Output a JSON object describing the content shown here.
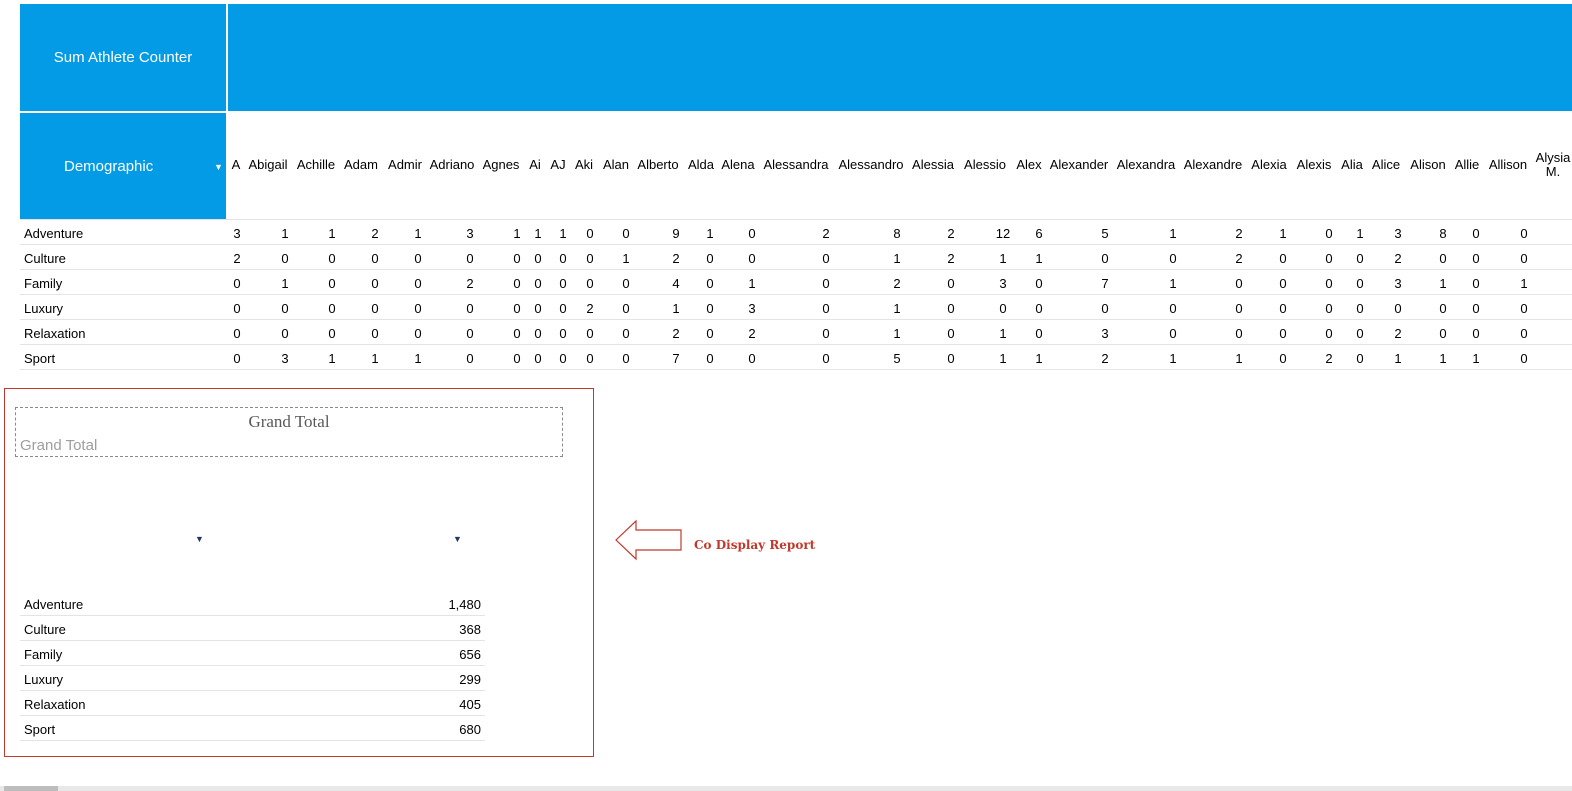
{
  "pivot": {
    "corner_label": "Sum Athlete Counter",
    "row_field_label": "Demographic",
    "columns": [
      "A",
      "Abigail",
      "Achille",
      "Adam",
      "Admir",
      "Adriano",
      "Agnes",
      "Ai",
      "AJ",
      "Aki",
      "Alan",
      "Alberto",
      "Alda",
      "Alena",
      "Alessandra",
      "Alessandro",
      "Alessia",
      "Alessio",
      "Alex",
      "Alexander",
      "Alexandra",
      "Alexandre",
      "Alexia",
      "Alexis",
      "Alia",
      "Alice",
      "Alison",
      "Allie",
      "Allison",
      "Alysia M."
    ],
    "rows": [
      {
        "label": "Adventure",
        "values": [
          "3",
          "1",
          "1",
          "2",
          "1",
          "3",
          "1",
          "1",
          "1",
          "0",
          "0",
          "9",
          "1",
          "0",
          "2",
          "8",
          "2",
          "12",
          "6",
          "5",
          "1",
          "2",
          "1",
          "0",
          "1",
          "3",
          "8",
          "0",
          "0",
          ""
        ]
      },
      {
        "label": "Culture",
        "values": [
          "2",
          "0",
          "0",
          "0",
          "0",
          "0",
          "0",
          "0",
          "0",
          "0",
          "1",
          "2",
          "0",
          "0",
          "0",
          "1",
          "2",
          "1",
          "1",
          "0",
          "0",
          "2",
          "0",
          "0",
          "0",
          "2",
          "0",
          "0",
          "0",
          ""
        ]
      },
      {
        "label": "Family",
        "values": [
          "0",
          "1",
          "0",
          "0",
          "0",
          "2",
          "0",
          "0",
          "0",
          "0",
          "0",
          "4",
          "0",
          "1",
          "0",
          "2",
          "0",
          "3",
          "0",
          "7",
          "1",
          "0",
          "0",
          "0",
          "0",
          "3",
          "1",
          "0",
          "1",
          ""
        ]
      },
      {
        "label": "Luxury",
        "values": [
          "0",
          "0",
          "0",
          "0",
          "0",
          "0",
          "0",
          "0",
          "0",
          "2",
          "0",
          "1",
          "0",
          "3",
          "0",
          "1",
          "0",
          "0",
          "0",
          "0",
          "0",
          "0",
          "0",
          "0",
          "0",
          "0",
          "0",
          "0",
          "0",
          ""
        ]
      },
      {
        "label": "Relaxation",
        "values": [
          "0",
          "0",
          "0",
          "0",
          "0",
          "0",
          "0",
          "0",
          "0",
          "0",
          "0",
          "2",
          "0",
          "2",
          "0",
          "1",
          "0",
          "1",
          "0",
          "3",
          "0",
          "0",
          "0",
          "0",
          "0",
          "2",
          "0",
          "0",
          "0",
          ""
        ]
      },
      {
        "label": "Sport",
        "values": [
          "0",
          "3",
          "1",
          "1",
          "1",
          "0",
          "0",
          "0",
          "0",
          "0",
          "0",
          "7",
          "0",
          "0",
          "0",
          "5",
          "0",
          "1",
          "1",
          "2",
          "1",
          "1",
          "0",
          "2",
          "0",
          "1",
          "1",
          "1",
          "0",
          ""
        ]
      }
    ]
  },
  "report": {
    "title": "Grand Total",
    "subtitle": "Grand Total",
    "rows": [
      {
        "label": "Adventure",
        "value": "1,480"
      },
      {
        "label": "Culture",
        "value": "368"
      },
      {
        "label": "Family",
        "value": "656"
      },
      {
        "label": "Luxury",
        "value": "299"
      },
      {
        "label": "Relaxation",
        "value": "405"
      },
      {
        "label": "Sport",
        "value": "680"
      }
    ]
  },
  "callout": {
    "text": "Co Display Report"
  },
  "colors": {
    "header_blue": "#039be5",
    "callout_red": "#c0392b"
  },
  "icons": {
    "dropdown": "caret-down-icon",
    "arrow": "left-arrow-icon"
  }
}
